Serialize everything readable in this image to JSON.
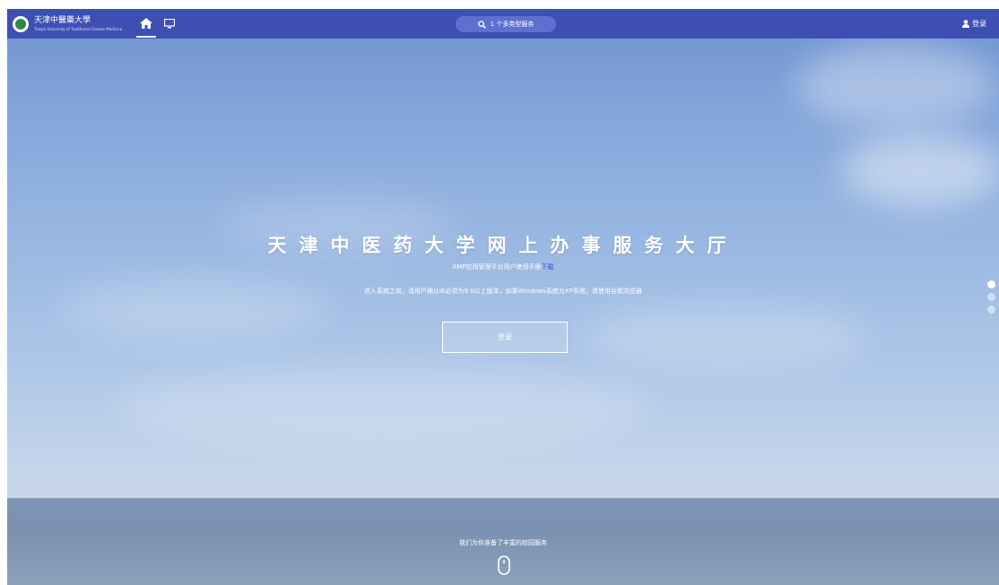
{
  "colors": {
    "navbar": "#3e4fb4",
    "search_bg": "#5f6fd0",
    "link": "#2f4fd8",
    "sky_top": "#6f93d0",
    "sea": "#7b91b0"
  },
  "logo": {
    "name_cn": "天津中醫藥大學",
    "name_en": "Tianjin University of Traditional Chinese Medicine"
  },
  "navbar": {
    "nav_items": [
      {
        "icon": "home-icon",
        "active": true
      },
      {
        "icon": "desktop-icon",
        "active": false
      }
    ],
    "search": {
      "icon": "search-icon",
      "label": "1 个多类型服务"
    },
    "login": {
      "icon": "user-icon",
      "label": "登录"
    }
  },
  "hero": {
    "title": "天津中医药大学网上办事服务大厅",
    "manual_text": "AMP应用管理平台用户使用手册",
    "manual_link": "下载",
    "notice": "进入系统之前，请用户确认IE必须为9.0以上版本，如果Windows系统为XP系统，请使用谷歌浏览器",
    "login_button": "登录"
  },
  "slider": {
    "count": 3,
    "active_index": 0
  },
  "footer": {
    "tagline": "我们为你准备了丰富的校园服务",
    "scroll_icon": "mouse-icon"
  }
}
